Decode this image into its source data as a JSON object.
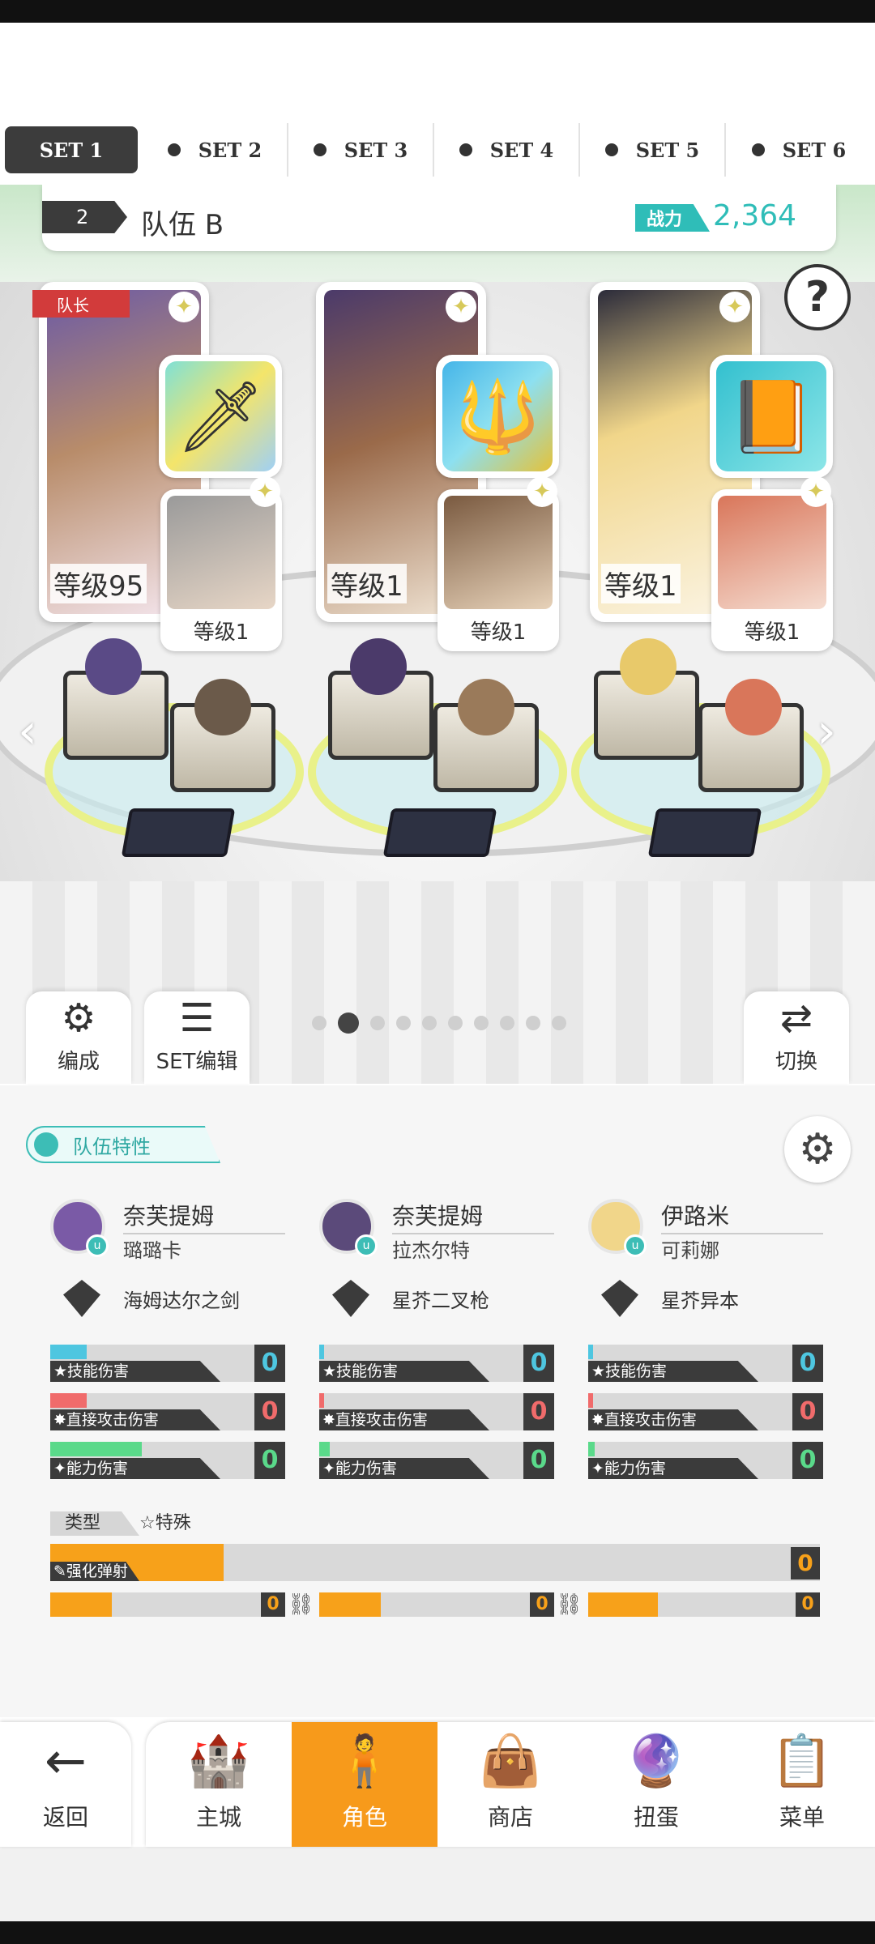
{
  "tabs": [
    {
      "label": "SET 1",
      "active": true
    },
    {
      "label": "SET 2",
      "active": false
    },
    {
      "label": "SET 3",
      "active": false
    },
    {
      "label": "SET 4",
      "active": false
    },
    {
      "label": "SET 5",
      "active": false
    },
    {
      "label": "SET 6",
      "active": false
    }
  ],
  "team": {
    "number": "2",
    "name": "队伍 B",
    "power_label": "战力",
    "power_value": "2,364"
  },
  "help_icon": "question-mark-icon",
  "cards": [
    {
      "leader_badge": "队长",
      "level": "等级95",
      "support_level": "等级1",
      "weapon_icon": "sword-icon"
    },
    {
      "level": "等级1",
      "support_level": "等级1",
      "weapon_icon": "spear-icon"
    },
    {
      "level": "等级1",
      "support_level": "等级1",
      "weapon_icon": "book-icon"
    }
  ],
  "pager": {
    "total": 10,
    "current": 2
  },
  "side_buttons": {
    "formation": "编成",
    "set_edit": "SET编辑",
    "switch": "切换"
  },
  "trait_label": "队伍特性",
  "members": [
    {
      "name": "奈芙提姆",
      "support": "璐璐卡",
      "weapon": "海姆达尔之剑",
      "skill_dmg": "0",
      "direct_dmg": "0",
      "ability_dmg": "0",
      "skill_fill": 0.18,
      "direct_fill": 0.18,
      "ability_fill": 0.45
    },
    {
      "name": "奈芙提姆",
      "support": "拉杰尔特",
      "weapon": "星芥二叉枪",
      "skill_dmg": "0",
      "direct_dmg": "0",
      "ability_dmg": "0",
      "skill_fill": 0.02,
      "direct_fill": 0.02,
      "ability_fill": 0.05
    },
    {
      "name": "伊路米",
      "support": "可莉娜",
      "weapon": "星芥异本",
      "skill_dmg": "0",
      "direct_dmg": "0",
      "ability_dmg": "0",
      "skill_fill": 0.01,
      "direct_fill": 0.01,
      "ability_fill": 0.03
    }
  ],
  "stat_labels": {
    "skill": "★技能伤害",
    "direct": "✸直接攻击伤害",
    "ability": "✦能力伤害"
  },
  "type_section": {
    "label": "类型",
    "value": "☆特殊",
    "bar_label": "✎强化弹射",
    "bar_value": "0",
    "sub_values": [
      "0",
      "0",
      "0"
    ]
  },
  "nav": [
    {
      "label": "返回",
      "icon": "back-arrow-icon"
    },
    {
      "label": "主城",
      "icon": "castle-icon"
    },
    {
      "label": "角色",
      "icon": "character-icon",
      "active": true
    },
    {
      "label": "商店",
      "icon": "shop-icon"
    },
    {
      "label": "扭蛋",
      "icon": "gacha-icon"
    },
    {
      "label": "菜单",
      "icon": "menu-icon"
    }
  ],
  "colors": {
    "accent_teal": "#2fbdb8",
    "nav_active": "#f79a1b",
    "skill": "#4ec6e0",
    "direct": "#f06b6b",
    "ability": "#5ad98a"
  }
}
